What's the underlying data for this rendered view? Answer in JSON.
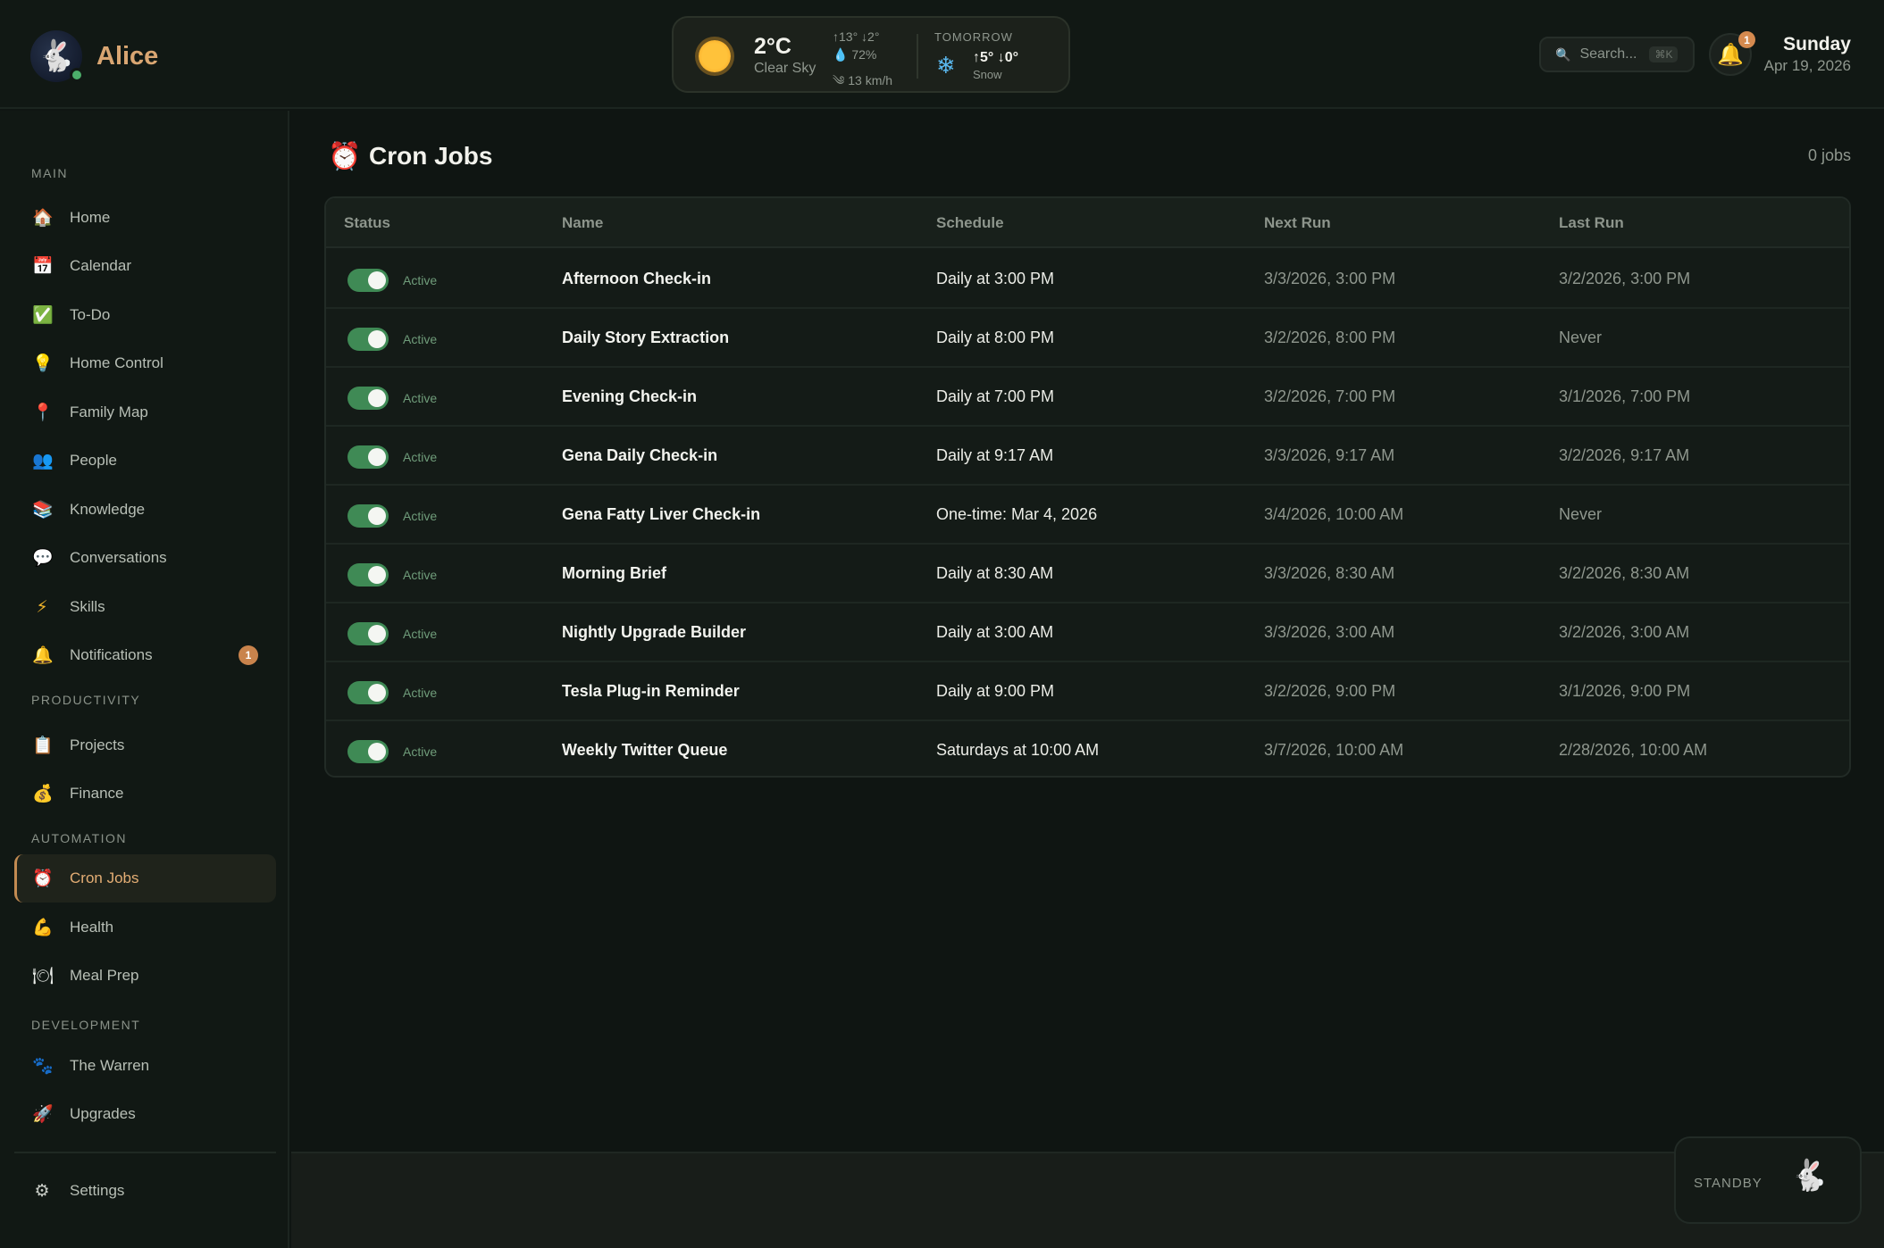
{
  "header": {
    "brand_name": "Alice",
    "weather": {
      "temp": "2°C",
      "condition": "Clear Sky",
      "hilo": "↑13° ↓2°",
      "humidity": "72%",
      "wind": "13 km/h",
      "tomorrow_label": "TOMORROW",
      "tomorrow_temp": "↑5° ↓0°",
      "tomorrow_condition": "Snow"
    },
    "search_placeholder": "Search...",
    "search_shortcut": "⌘K",
    "notification_count": "1",
    "day": "Sunday",
    "date": "Apr 19, 2026"
  },
  "sidebar": {
    "sections": {
      "main": "MAIN",
      "productivity": "PRODUCTIVITY",
      "automation": "AUTOMATION",
      "development": "DEVELOPMENT"
    },
    "items": [
      {
        "label": "Home",
        "icon": "house-icon"
      },
      {
        "label": "Calendar",
        "icon": "calendar-icon"
      },
      {
        "label": "To-Do",
        "icon": "check-icon"
      },
      {
        "label": "Home Control",
        "icon": "bulb-icon"
      },
      {
        "label": "Family Map",
        "icon": "pin-icon"
      },
      {
        "label": "People",
        "icon": "people-icon"
      },
      {
        "label": "Knowledge",
        "icon": "books-icon"
      },
      {
        "label": "Conversations",
        "icon": "speech-icon"
      },
      {
        "label": "Skills",
        "icon": "bolt-icon"
      },
      {
        "label": "Notifications",
        "icon": "bell-icon",
        "badge": "1"
      },
      {
        "label": "Projects",
        "icon": "clipboard-icon"
      },
      {
        "label": "Finance",
        "icon": "money-bag-icon"
      },
      {
        "label": "Cron Jobs",
        "icon": "alarm-clock-icon",
        "active": true
      },
      {
        "label": "Health",
        "icon": "muscle-icon"
      },
      {
        "label": "Meal Prep",
        "icon": "plate-icon"
      },
      {
        "label": "The Warren",
        "icon": "paw-icon"
      },
      {
        "label": "Upgrades",
        "icon": "rocket-icon"
      },
      {
        "label": "Settings",
        "icon": "gear-icon"
      }
    ]
  },
  "main": {
    "title": "Cron Jobs",
    "count": "0 jobs",
    "columns": [
      "Status",
      "Name",
      "Schedule",
      "Next Run",
      "Last Run"
    ],
    "rows": [
      {
        "status": "Active",
        "name": "Afternoon Check-in",
        "schedule": "Daily at 3:00 PM",
        "next": "3/3/2026, 3:00 PM",
        "last": "3/2/2026, 3:00 PM"
      },
      {
        "status": "Active",
        "name": "Daily Story Extraction",
        "schedule": "Daily at 8:00 PM",
        "next": "3/2/2026, 8:00 PM",
        "last": "Never"
      },
      {
        "status": "Active",
        "name": "Evening Check-in",
        "schedule": "Daily at 7:00 PM",
        "next": "3/2/2026, 7:00 PM",
        "last": "3/1/2026, 7:00 PM"
      },
      {
        "status": "Active",
        "name": "Gena Daily Check-in",
        "schedule": "Daily at 9:17 AM",
        "next": "3/3/2026, 9:17 AM",
        "last": "3/2/2026, 9:17 AM"
      },
      {
        "status": "Active",
        "name": "Gena Fatty Liver Check-in",
        "schedule": "One-time: Mar 4, 2026",
        "next": "3/4/2026, 10:00 AM",
        "last": "Never"
      },
      {
        "status": "Active",
        "name": "Morning Brief",
        "schedule": "Daily at 8:30 AM",
        "next": "3/3/2026, 8:30 AM",
        "last": "3/2/2026, 8:30 AM"
      },
      {
        "status": "Active",
        "name": "Nightly Upgrade Builder",
        "schedule": "Daily at 3:00 AM",
        "next": "3/3/2026, 3:00 AM",
        "last": "3/2/2026, 3:00 AM"
      },
      {
        "status": "Active",
        "name": "Tesla Plug-in Reminder",
        "schedule": "Daily at 9:00 PM",
        "next": "3/2/2026, 9:00 PM",
        "last": "3/1/2026, 9:00 PM"
      },
      {
        "status": "Active",
        "name": "Weekly Twitter Queue",
        "schedule": "Saturdays at 10:00 AM",
        "next": "3/7/2026, 10:00 AM",
        "last": "2/28/2026, 10:00 AM"
      }
    ]
  },
  "standby": {
    "label": "STANDBY"
  },
  "colors": {
    "accent": "#d9a672",
    "toggle_on": "#3f8a55",
    "badge": "#c9834c"
  }
}
